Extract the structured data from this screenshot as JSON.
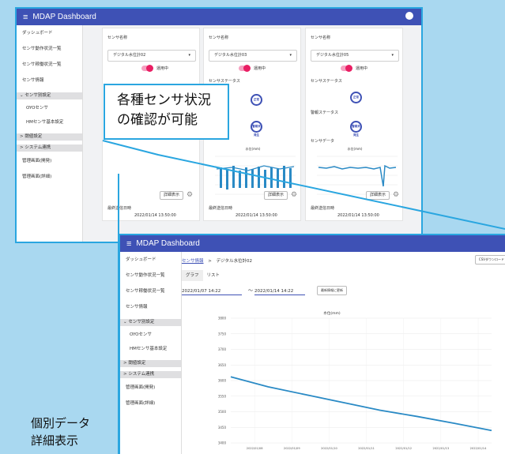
{
  "app_title": "MDAP Dashboard",
  "sidebar": {
    "items": [
      "ダッシュボード",
      "センサ動作状況一覧",
      "センサ稼働状況一覧",
      "センサ情報"
    ],
    "group1": "センサ別設定",
    "group1_items": [
      "OYOセンサ",
      "HMセンサ基本設定"
    ],
    "group2": "閾値設定",
    "group3": "システム連携",
    "bottom_items": [
      "管理画面(開発)",
      "管理画面(詳細)"
    ]
  },
  "cards": [
    {
      "sensor_label": "センサ名称",
      "sensor_value": "デジタル水位計02",
      "operating": "運用中",
      "latest_label": "最終送信日時",
      "latest_value": "2022/01/14 13:50:00",
      "detail": "詳細表示"
    },
    {
      "sensor_label": "センサ名称",
      "sensor_value": "デジタル水位計03",
      "operating": "運用中",
      "status_label": "センサステータス",
      "status_badge": "正常",
      "alarm_badge": "警報未発生",
      "chart_title": "水位(mm)",
      "latest_label": "最終送信日時",
      "latest_value": "2022/01/14 13:50:00",
      "detail": "詳細表示"
    },
    {
      "sensor_label": "センサ名称",
      "sensor_value": "デジタル水位計05",
      "operating": "運用中",
      "status_label": "センサステータス",
      "alarm_label": "警報ステータス",
      "data_label": "センサデータ",
      "status_badge": "正常",
      "alarm_badge": "警報未発生",
      "chart_title": "水位(mm)",
      "latest_label": "最終送信日時",
      "latest_value": "2022/01/14 13:50:00",
      "detail": "詳細表示"
    }
  ],
  "callout": {
    "line1": "各種センサ状況",
    "line2": "の確認が可能"
  },
  "detail_view": {
    "breadcrumb_link": "センサ情報",
    "breadcrumb_sep": ">",
    "breadcrumb_current": "デジタル水位計02",
    "csv_button": "CSVダウンロード",
    "tabs": [
      "グラフ",
      "リスト"
    ],
    "date_from": "2022/01/07 14:22",
    "tilde": "〜",
    "date_to": "2022/01/14 14:22",
    "update_button": "最新情報に更新"
  },
  "chart_data": {
    "type": "line",
    "title": "水位(mm)",
    "categories": [
      "2022/01/08",
      "2022/01/09",
      "2022/01/10",
      "2022/01/11",
      "2022/01/12",
      "2022/01/13",
      "2022/01/14"
    ],
    "y_ticks": [
      3400,
      3450,
      3500,
      3550,
      3600,
      3650,
      3700,
      3750,
      3800
    ],
    "ylim": [
      3400,
      3800
    ],
    "x": [
      0,
      1,
      2,
      3,
      4,
      5,
      6,
      7
    ],
    "values": [
      3612,
      3580,
      3555,
      3530,
      3505,
      3485,
      3463,
      3440
    ],
    "color": "#2a8ac5"
  },
  "caption": {
    "line1": "個別データ",
    "line2": "詳細表示"
  },
  "colors": {
    "accent": "#3e51b5",
    "frame": "#2aa6e0",
    "toggle": "#e91e63"
  }
}
